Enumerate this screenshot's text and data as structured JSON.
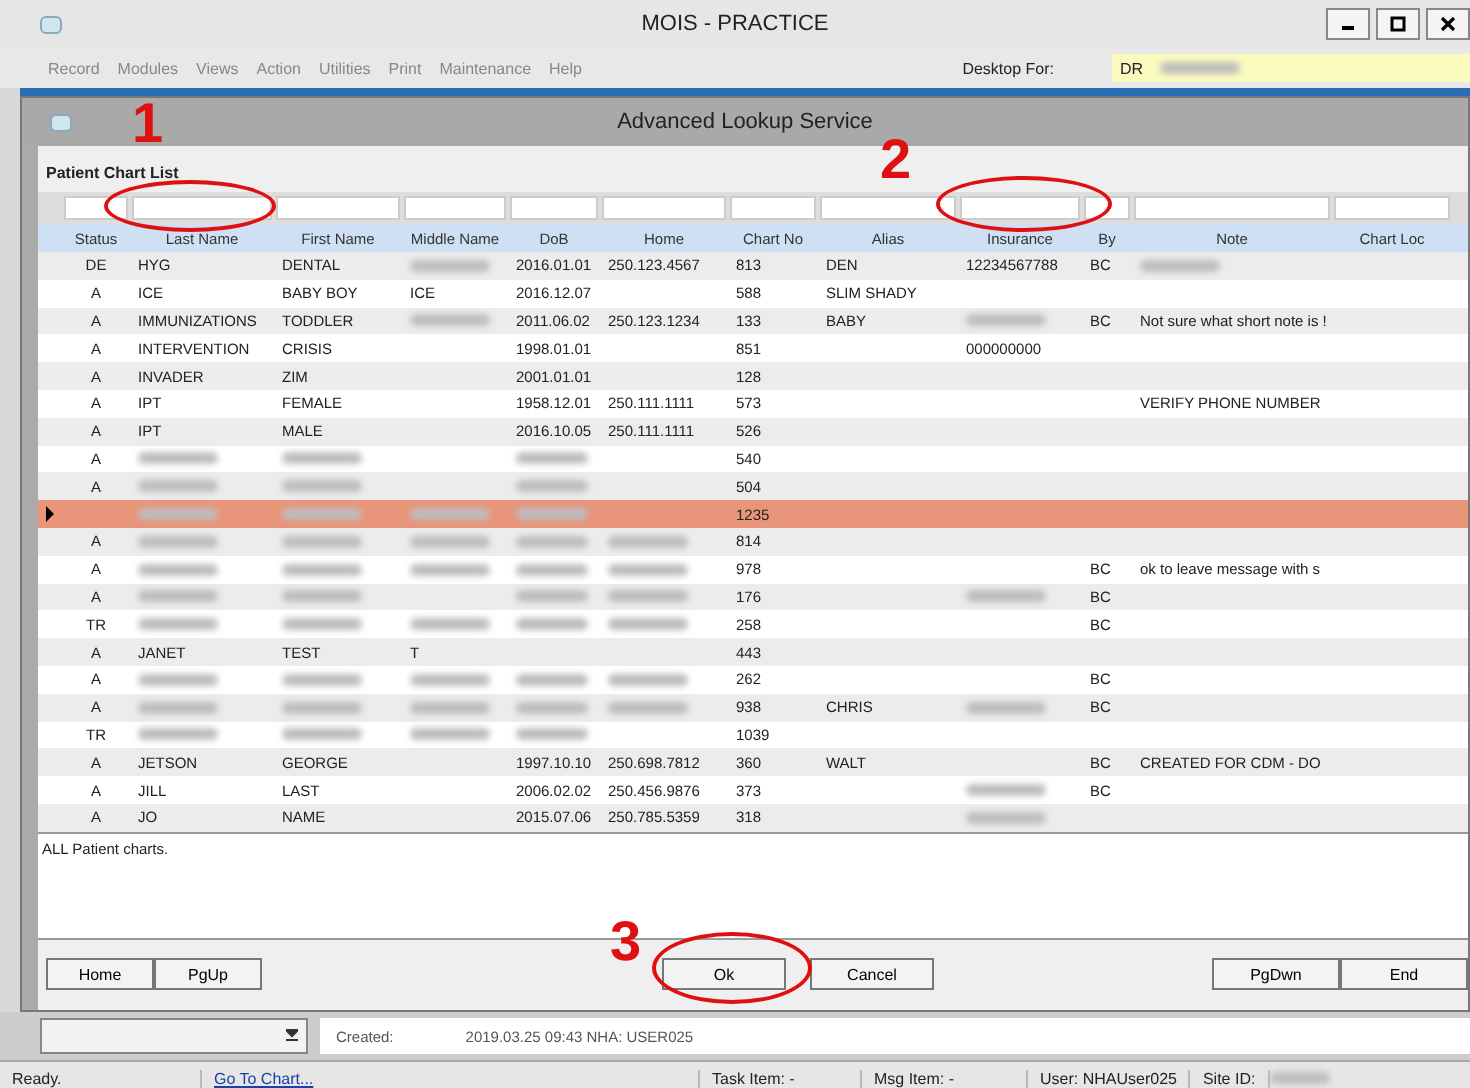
{
  "main_window": {
    "title": "MOIS - PRACTICE",
    "menu": [
      "Record",
      "Modules",
      "Views",
      "Action",
      "Utilities",
      "Print",
      "Maintenance",
      "Help"
    ],
    "desktop_label": "Desktop For:",
    "desktop_value": "DR"
  },
  "dialog": {
    "title": "Advanced Lookup Service",
    "section": "Patient Chart List",
    "columns": [
      "Status",
      "Last Name",
      "First Name",
      "Middle Name",
      "DoB",
      "Home",
      "Chart No",
      "Alias",
      "Insurance",
      "By",
      "Note",
      "Chart Loc"
    ],
    "rows": [
      {
        "selected": false,
        "cells": [
          "DE",
          "HYG",
          "DENTAL",
          {
            "kind": "blurred"
          },
          "2016.01.01",
          "250.123.4567",
          "813",
          "DEN",
          "12234567788",
          "BC",
          {
            "kind": "blurred"
          },
          null
        ]
      },
      {
        "selected": false,
        "cells": [
          "A",
          "ICE",
          "BABY BOY",
          "ICE",
          "2016.12.07",
          null,
          "588",
          "SLIM SHADY",
          null,
          null,
          null,
          null
        ]
      },
      {
        "selected": false,
        "cells": [
          "A",
          "IMMUNIZATIONS",
          "TODDLER",
          {
            "kind": "blurred"
          },
          "2011.06.02",
          "250.123.1234",
          "133",
          "BABY",
          {
            "kind": "blurred"
          },
          "BC",
          "Not sure what short note is !",
          null
        ]
      },
      {
        "selected": false,
        "cells": [
          "A",
          "INTERVENTION",
          "CRISIS",
          null,
          "1998.01.01",
          null,
          "851",
          null,
          "000000000",
          null,
          null,
          null
        ]
      },
      {
        "selected": false,
        "cells": [
          "A",
          "INVADER",
          "ZIM",
          null,
          "2001.01.01",
          null,
          "128",
          null,
          null,
          null,
          null,
          null
        ]
      },
      {
        "selected": false,
        "cells": [
          "A",
          "IPT",
          "FEMALE",
          null,
          "1958.12.01",
          "250.111.1111",
          "573",
          null,
          null,
          null,
          "VERIFY PHONE NUMBER",
          null
        ]
      },
      {
        "selected": false,
        "cells": [
          "A",
          "IPT",
          "MALE",
          null,
          "2016.10.05",
          "250.111.1111",
          "526",
          null,
          null,
          null,
          null,
          null
        ]
      },
      {
        "selected": false,
        "cells": [
          "A",
          {
            "kind": "blurred"
          },
          {
            "kind": "blurred"
          },
          null,
          {
            "kind": "blurred"
          },
          null,
          "540",
          null,
          null,
          null,
          null,
          null
        ]
      },
      {
        "selected": false,
        "cells": [
          "A",
          {
            "kind": "blurred"
          },
          {
            "kind": "blurred"
          },
          null,
          {
            "kind": "blurred"
          },
          null,
          "504",
          null,
          null,
          null,
          null,
          null
        ]
      },
      {
        "selected": true,
        "cells": [
          null,
          {
            "kind": "blurred"
          },
          {
            "kind": "blurred"
          },
          {
            "kind": "blurred"
          },
          {
            "kind": "blurred"
          },
          null,
          "1235",
          null,
          null,
          null,
          null,
          null
        ]
      },
      {
        "selected": false,
        "cells": [
          "A",
          {
            "kind": "blurred"
          },
          {
            "kind": "blurred"
          },
          {
            "kind": "blurred"
          },
          {
            "kind": "blurred"
          },
          {
            "kind": "blurred"
          },
          "814",
          null,
          null,
          null,
          null,
          null
        ]
      },
      {
        "selected": false,
        "cells": [
          "A",
          {
            "kind": "blurred"
          },
          {
            "kind": "blurred"
          },
          {
            "kind": "blurred"
          },
          {
            "kind": "blurred"
          },
          {
            "kind": "blurred"
          },
          "978",
          null,
          null,
          "BC",
          "ok to leave message with s",
          null
        ]
      },
      {
        "selected": false,
        "cells": [
          "A",
          {
            "kind": "blurred"
          },
          {
            "kind": "blurred"
          },
          null,
          {
            "kind": "blurred"
          },
          {
            "kind": "blurred"
          },
          "176",
          null,
          {
            "kind": "blurred"
          },
          "BC",
          null,
          null
        ]
      },
      {
        "selected": false,
        "cells": [
          "TR",
          {
            "kind": "blurred"
          },
          {
            "kind": "blurred"
          },
          {
            "kind": "blurred"
          },
          {
            "kind": "blurred"
          },
          {
            "kind": "blurred"
          },
          "258",
          null,
          null,
          "BC",
          null,
          null
        ]
      },
      {
        "selected": false,
        "cells": [
          "A",
          "JANET",
          "TEST",
          "T",
          null,
          null,
          "443",
          null,
          null,
          null,
          null,
          null
        ]
      },
      {
        "selected": false,
        "cells": [
          "A",
          {
            "kind": "blurred"
          },
          {
            "kind": "blurred"
          },
          {
            "kind": "blurred"
          },
          {
            "kind": "blurred"
          },
          {
            "kind": "blurred"
          },
          "262",
          null,
          null,
          "BC",
          null,
          null
        ]
      },
      {
        "selected": false,
        "cells": [
          "A",
          {
            "kind": "blurred"
          },
          {
            "kind": "blurred"
          },
          {
            "kind": "blurred"
          },
          {
            "kind": "blurred"
          },
          {
            "kind": "blurred"
          },
          "938",
          "CHRIS",
          {
            "kind": "blurred"
          },
          "BC",
          null,
          null
        ]
      },
      {
        "selected": false,
        "cells": [
          "TR",
          {
            "kind": "blurred"
          },
          {
            "kind": "blurred"
          },
          {
            "kind": "blurred"
          },
          {
            "kind": "blurred"
          },
          null,
          "1039",
          null,
          null,
          null,
          null,
          null
        ]
      },
      {
        "selected": false,
        "cells": [
          "A",
          "JETSON",
          "GEORGE",
          null,
          "1997.10.10",
          "250.698.7812",
          "360",
          "WALT",
          null,
          "BC",
          "CREATED FOR CDM - DO",
          null
        ]
      },
      {
        "selected": false,
        "cells": [
          "A",
          "JILL",
          "LAST",
          null,
          "2006.02.02",
          "250.456.9876",
          "373",
          null,
          {
            "kind": "blurred"
          },
          "BC",
          null,
          null
        ]
      },
      {
        "selected": false,
        "cells": [
          "A",
          "JO",
          "NAME",
          null,
          "2015.07.06",
          "250.785.5359",
          "318",
          null,
          {
            "kind": "blurred"
          },
          null,
          null,
          null
        ]
      }
    ],
    "description": "ALL Patient charts.",
    "buttons_left": [
      "Home",
      "PgUp"
    ],
    "buttons_center": [
      "Ok",
      "Cancel"
    ],
    "buttons_right": [
      "PgDwn",
      "End"
    ]
  },
  "background": {
    "created": "Created:",
    "created_value": "2019.03.25  09:43  NHA: USER025"
  },
  "status_bar": {
    "ready": "Ready.",
    "link": "Go To Chart...",
    "task": "Task Item:  -",
    "msg": "Msg Item:  -",
    "user": "User: NHAUser025",
    "site": "Site ID:"
  },
  "annotations": [
    {
      "number": "1"
    },
    {
      "number": "2"
    },
    {
      "number": "3"
    }
  ]
}
